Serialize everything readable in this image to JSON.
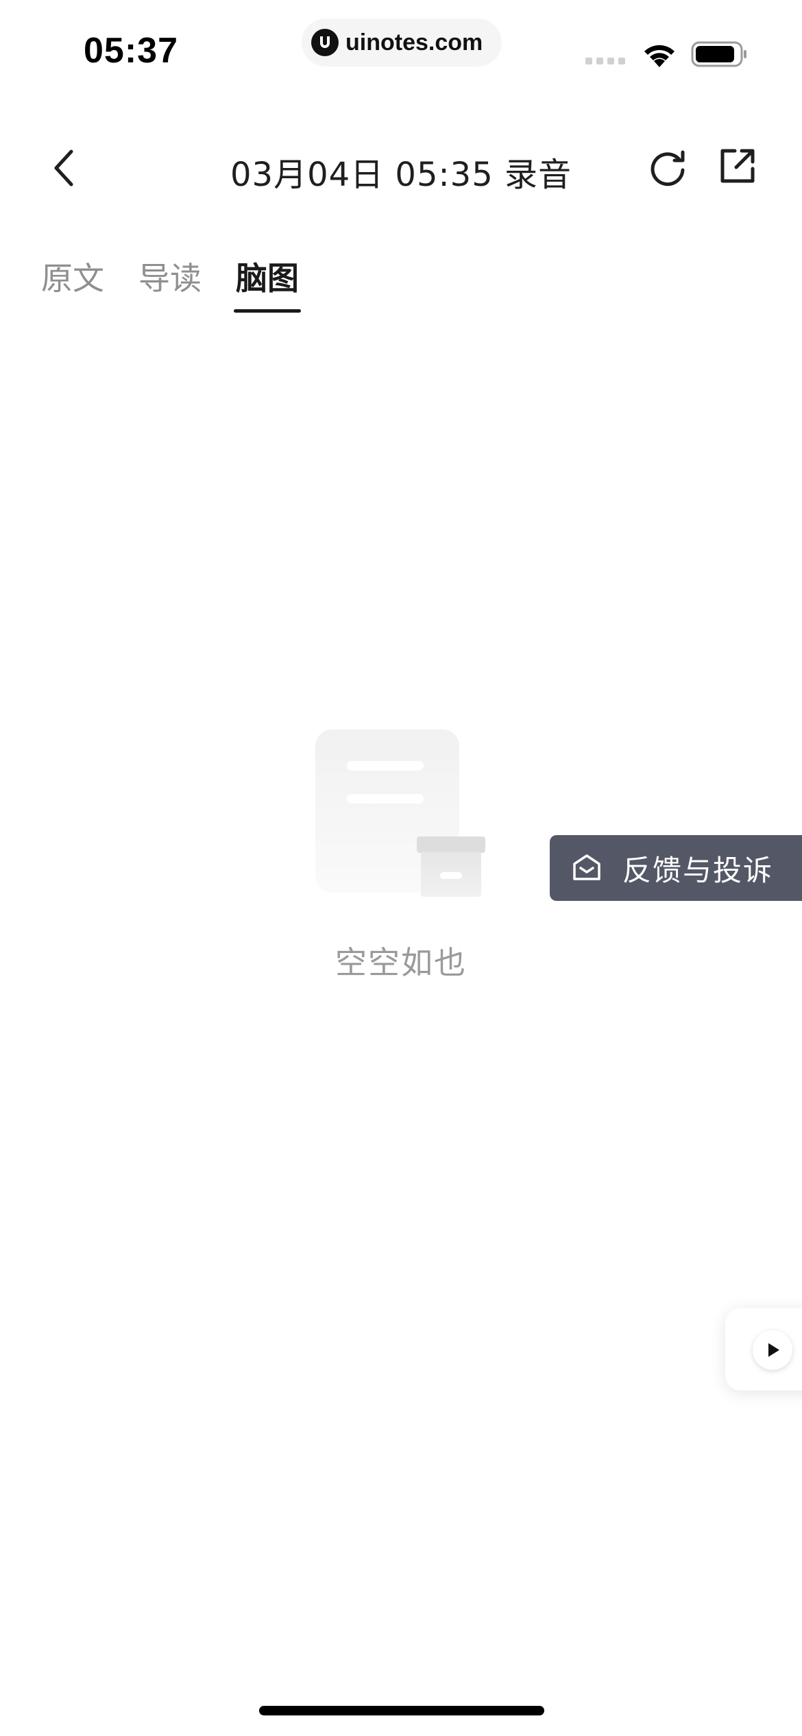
{
  "status_bar": {
    "time": "05:37",
    "url": "uinotes.com"
  },
  "nav": {
    "title": "03月04日 05:35 录音"
  },
  "tabs": [
    {
      "label": "原文",
      "active": false
    },
    {
      "label": "导读",
      "active": false
    },
    {
      "label": "脑图",
      "active": true
    }
  ],
  "empty_state": {
    "text": "空空如也"
  },
  "feedback": {
    "label": "反馈与投诉"
  },
  "icons": {
    "back": "chevron-left-icon",
    "refresh": "refresh-icon",
    "share": "share-icon",
    "feedback": "mail-open-icon",
    "play": "play-icon"
  },
  "colors": {
    "feedback_bg": "#545766",
    "active_tab": "#1a1a1a",
    "inactive_tab": "#8f8f8f",
    "empty_text": "#9a9a9a"
  }
}
